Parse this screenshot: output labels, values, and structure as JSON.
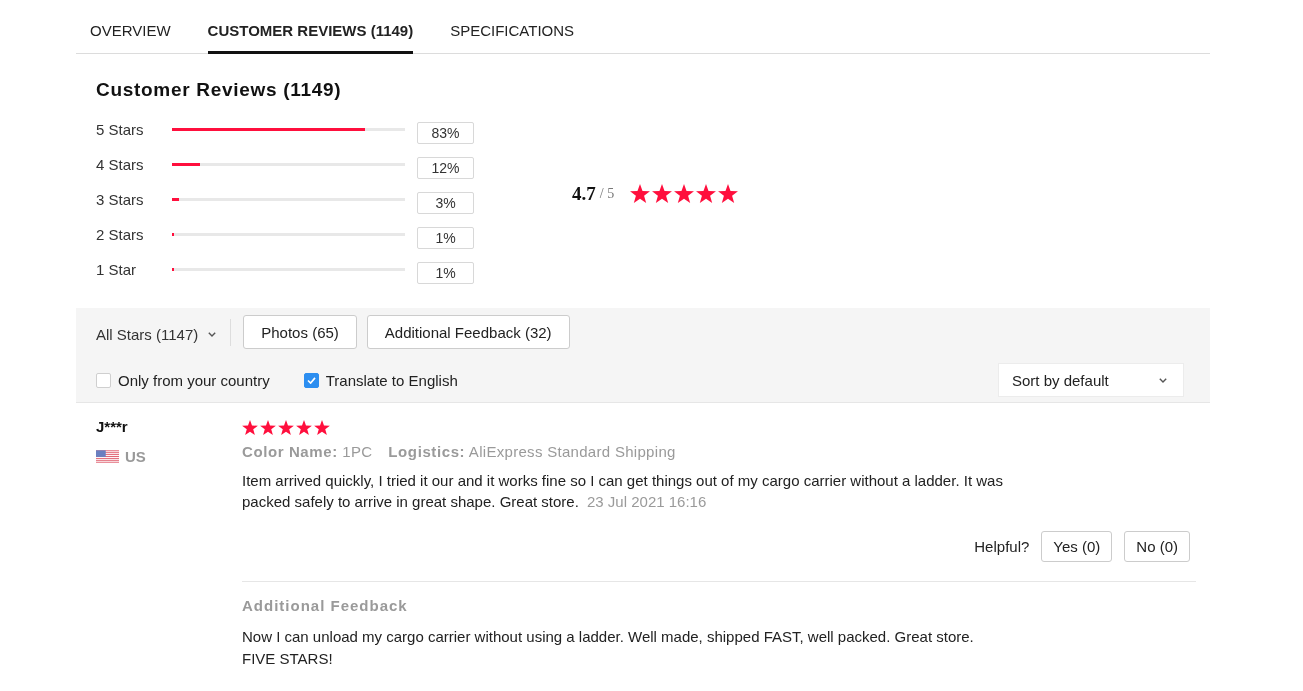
{
  "tabs": [
    {
      "label": "OVERVIEW",
      "selected": false
    },
    {
      "label": "CUSTOMER REVIEWS (1149)",
      "selected": true
    },
    {
      "label": "SPECIFICATIONS",
      "selected": false
    }
  ],
  "summary": {
    "title": "Customer Reviews (1149)",
    "distribution": [
      {
        "label": "5 Stars",
        "level": 0.83,
        "percent": "83%"
      },
      {
        "label": "4 Stars",
        "level": 0.12,
        "percent": "12%"
      },
      {
        "label": "3 Stars",
        "level": 0.03,
        "percent": "3%"
      },
      {
        "label": "2 Stars",
        "level": 0.01,
        "percent": "1%"
      },
      {
        "label": "1 Star",
        "level": 0.01,
        "percent": "1%"
      }
    ],
    "rating": {
      "score": "4.7",
      "scale": "/ 5",
      "stars": 5
    }
  },
  "filters": {
    "star_filter": "All Stars (1147)",
    "buttons": [
      "Photos (65)",
      "Additional Feedback (32)"
    ],
    "options": [
      {
        "label": "Only from your country",
        "checked": false
      },
      {
        "label": "Translate to English",
        "checked": true
      }
    ],
    "sort": "Sort by default"
  },
  "reviews": [
    {
      "author": "J***r",
      "country": "US",
      "stars": 5,
      "attributes": [
        {
          "name": "Color Name:",
          "value": "1PC"
        },
        {
          "name": "Logistics:",
          "value": "AliExpress Standard Shipping"
        }
      ],
      "text": "Item arrived quickly, I tried it our and it works fine so I can get things out of my cargo carrier without a ladder. It was packed safely to arrive in great shape. Great store.",
      "date": "23 Jul 2021 16:16",
      "helpful": {
        "label": "Helpful?",
        "buttons": [
          "Yes (0)",
          "No (0)"
        ]
      },
      "additional_feedback": {
        "title": "Additional Feedback",
        "text": "Now I can unload my cargo carrier without using a ladder. Well made, shipped FAST, well packed. Great store.\nFIVE STARS!"
      }
    }
  ]
}
